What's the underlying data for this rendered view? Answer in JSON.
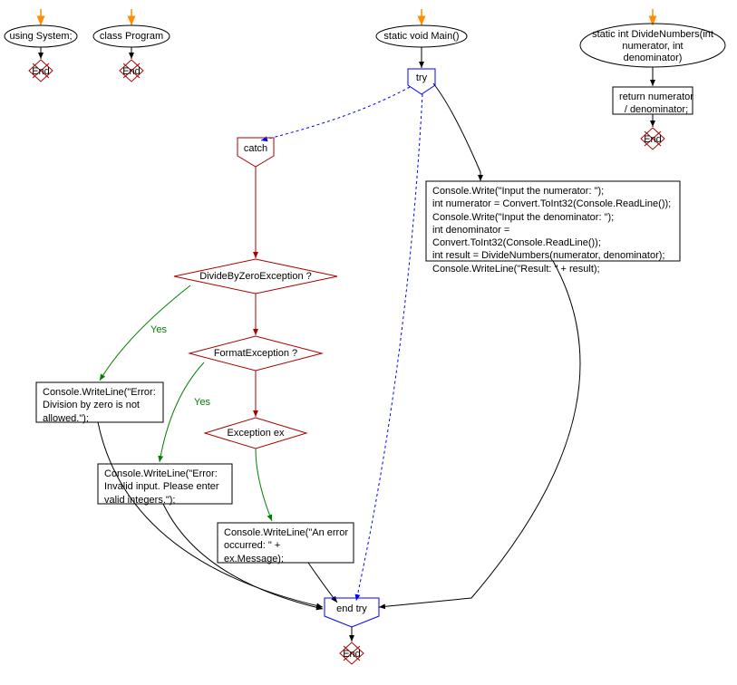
{
  "nodes": {
    "using_system": "using System;",
    "class_program": "class Program",
    "static_void_main": "static void Main()",
    "divide_numbers_def": "static int DivideNumbers(int\nnumerator, int\ndenominator)",
    "try": "try",
    "catch": "catch",
    "end_try": "end try",
    "end": "End",
    "return_stmt": "return numerator\n/ denominator;",
    "try_body": "Console.Write(\"Input the numerator: \");\nint numerator = Convert.ToInt32(Console.ReadLine());\nConsole.Write(\"Input the denominator: \");\nint denominator = Convert.ToInt32(Console.ReadLine());\nint result = DivideNumbers(numerator, denominator);\nConsole.WriteLine(\"Result: \" + result);",
    "divide_by_zero": "DivideByZeroException ?",
    "format_exception": "FormatException ?",
    "exception_ex": "Exception ex",
    "error_div_zero": "Console.WriteLine(\"Error:\nDivision by zero is not\nallowed.\");",
    "error_invalid": "Console.WriteLine(\"Error:\nInvalid input. Please enter\nvalid integers.\");",
    "error_generic": "Console.WriteLine(\"An error\noccurred: \" +\nex.Message);"
  },
  "labels": {
    "yes": "Yes"
  }
}
